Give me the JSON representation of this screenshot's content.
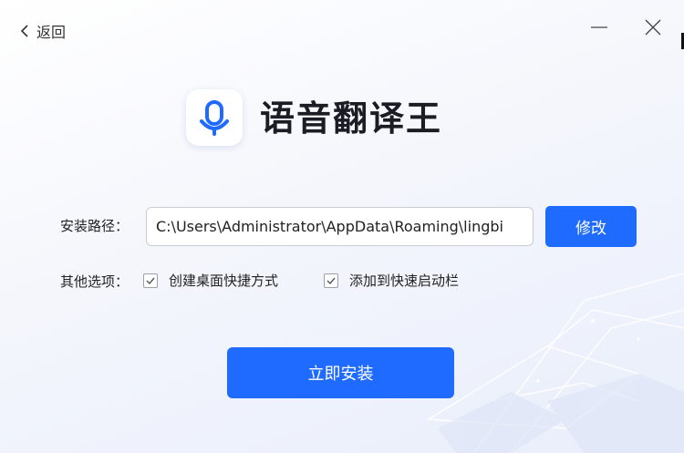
{
  "header": {
    "back_label": "返回",
    "back_icon": "chevron-left-icon",
    "minimize_icon": "minimize-icon",
    "close_icon": "close-icon"
  },
  "app": {
    "name": "语音翻译王",
    "logo_icon": "microphone-icon",
    "brand_color": "#1F6BFF"
  },
  "install_path": {
    "label": "安装路径：",
    "value": "C:\\Users\\Administrator\\AppData\\Roaming\\lingbi",
    "modify_label": "修改"
  },
  "options": {
    "label": "其他选项：",
    "items": [
      {
        "label": "创建桌面快捷方式",
        "checked": true
      },
      {
        "label": "添加到快速启动栏",
        "checked": true
      }
    ]
  },
  "install_button": {
    "label": "立即安装"
  }
}
